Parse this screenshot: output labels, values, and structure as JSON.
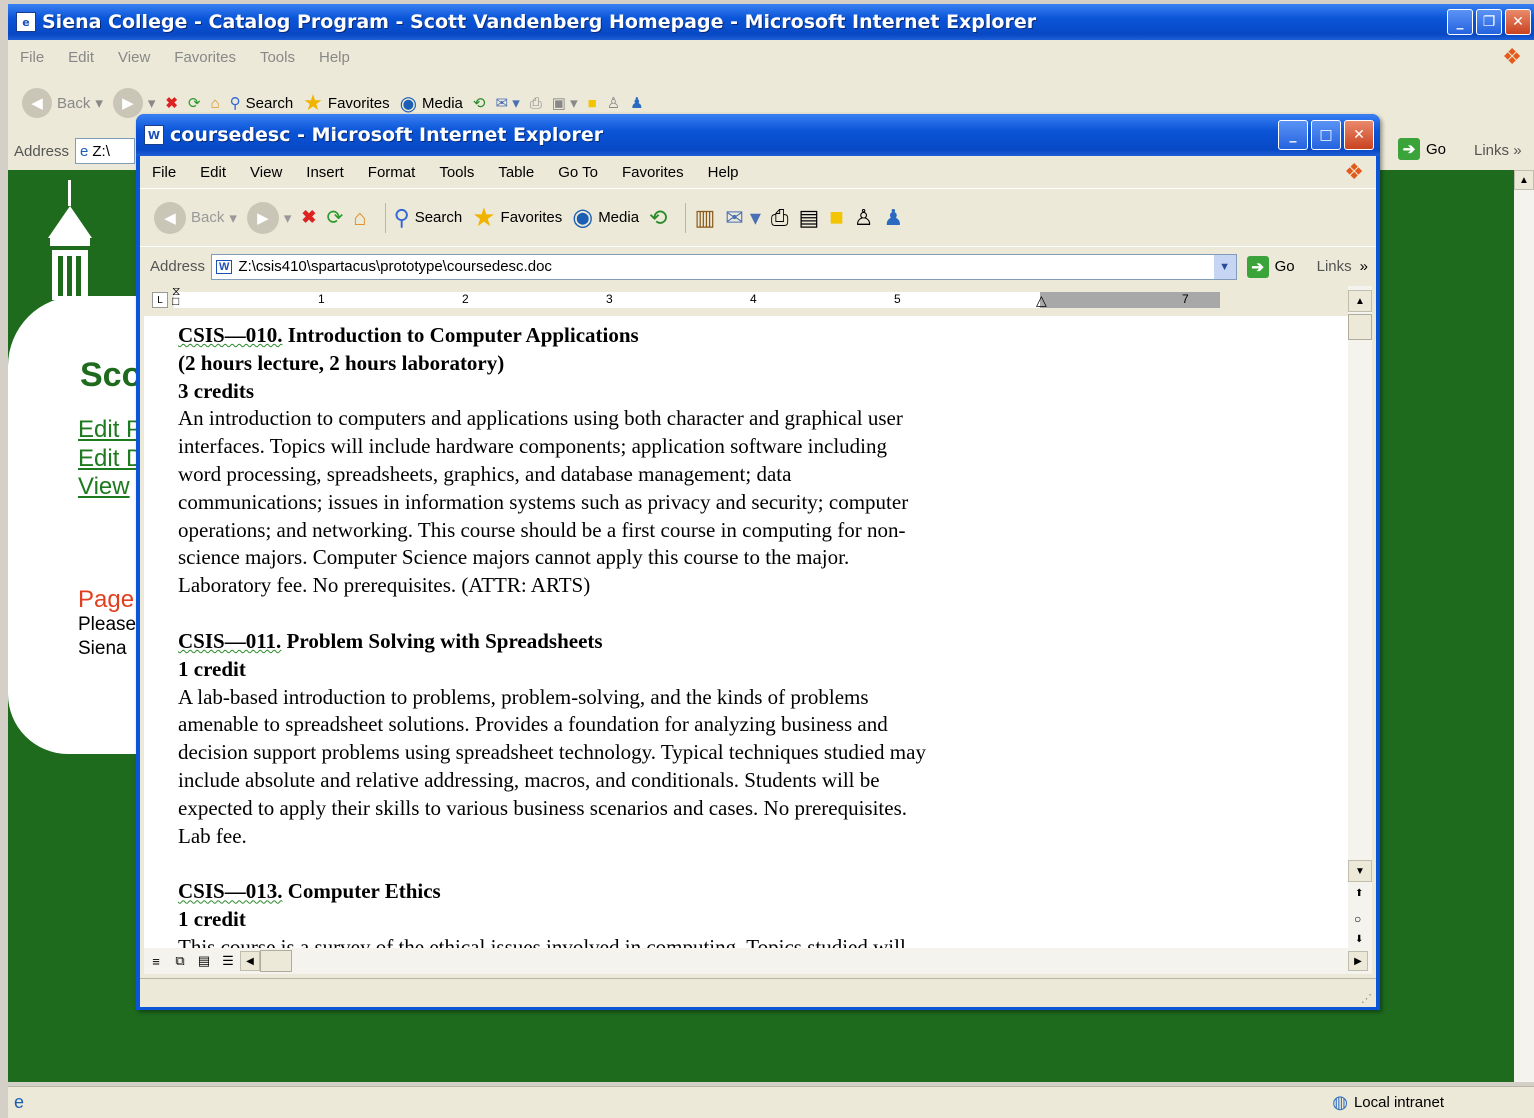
{
  "bg_window": {
    "title": "Siena College - Catalog Program - Scott Vandenberg Homepage - Microsoft Internet Explorer",
    "menu": [
      "File",
      "Edit",
      "View",
      "Favorites",
      "Tools",
      "Help"
    ],
    "toolbar": {
      "back": "Back",
      "search": "Search",
      "favorites": "Favorites",
      "media": "Media"
    },
    "address_label": "Address",
    "address_value": "Z:\\",
    "go": "Go",
    "links": "Links",
    "page": {
      "heading_partial": "Sco",
      "links": [
        "Edit P",
        "Edit D",
        "View"
      ],
      "page_label": "Page",
      "text_lines": [
        "Please",
        "Siena"
      ]
    },
    "status": "Local intranet"
  },
  "fg_window": {
    "title": "coursedesc - Microsoft Internet Explorer",
    "menu": [
      "File",
      "Edit",
      "View",
      "Insert",
      "Format",
      "Tools",
      "Table",
      "Go To",
      "Favorites",
      "Help"
    ],
    "toolbar": {
      "back": "Back",
      "search": "Search",
      "favorites": "Favorites",
      "media": "Media"
    },
    "address_label": "Address",
    "address_value": "Z:\\csis410\\spartacus\\prototype\\coursedesc.doc",
    "go": "Go",
    "links": "Links",
    "ruler_numbers": [
      "1",
      "2",
      "3",
      "4",
      "5",
      "7"
    ]
  },
  "document": {
    "courses": [
      {
        "code": "CSIS—010.",
        "title": " Introduction to Computer Applications",
        "lines": [
          "(2 hours lecture, 2 hours laboratory)",
          "3 credits"
        ],
        "desc": [
          "An introduction to computers and applications using both character and graphical user",
          "interfaces. Topics will include hardware components; application software including",
          "word processing, spreadsheets, graphics, and database management; data",
          "communications; issues in information systems such as privacy and security; computer",
          "operations; and networking. This course should be a first course in computing for non-",
          "science majors. Computer Science majors cannot apply this course to the major.",
          "Laboratory fee. No prerequisites. (ATTR: ARTS)"
        ]
      },
      {
        "code": "CSIS—011.",
        "title": " Problem Solving with Spreadsheets",
        "lines": [
          "1 credit"
        ],
        "desc": [
          "A lab-based introduction to problems, problem-solving, and the kinds of problems",
          "amenable to spreadsheet solutions. Provides a foundation for analyzing business and",
          "decision support problems using spreadsheet technology. Typical techniques studied may",
          "include absolute and relative addressing, macros, and conditionals. Students will be",
          "expected to apply their skills to various business scenarios and cases. No prerequisites.",
          "Lab fee."
        ]
      },
      {
        "code": "CSIS—013.",
        "title": " Computer Ethics",
        "lines": [
          "1 credit"
        ],
        "desc": [
          "This course is a survey of the ethical issues involved in computing. Topics studied will"
        ]
      }
    ]
  },
  "colors": {
    "xp_blue": "#0a55d8",
    "bg_green": "#1e6b1e",
    "siena_green": "#1e6b1e",
    "chrome": "#ece9d8"
  }
}
